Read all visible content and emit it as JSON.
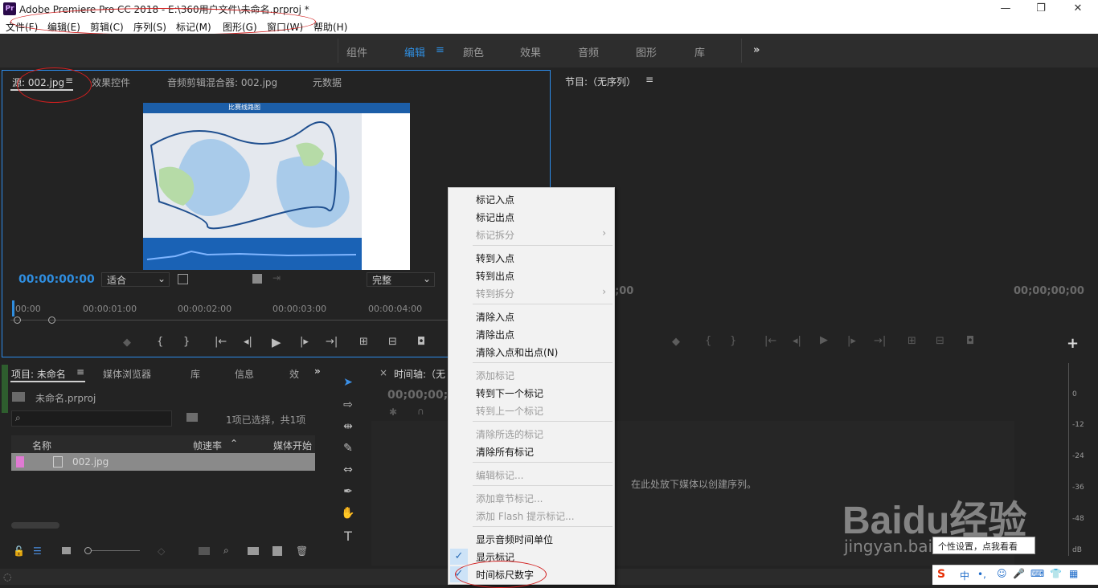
{
  "app": {
    "logo": "Pr",
    "title": "Adobe Premiere Pro CC 2018 - E:\\360用户文件\\未命名.prproj *",
    "min": "—",
    "max": "❐",
    "close": "✕"
  },
  "menu": [
    "文件(F)",
    "编辑(E)",
    "剪辑(C)",
    "序列(S)",
    "标记(M)",
    "图形(G)",
    "窗口(W)",
    "帮助(H)"
  ],
  "workspaces": {
    "items": [
      "组件",
      "编辑",
      "颜色",
      "效果",
      "音频",
      "图形",
      "库"
    ],
    "active": "编辑",
    "more": "»",
    "menu_glyph": "≡"
  },
  "source": {
    "tabs": [
      "源: 002.jpg",
      "效果控件",
      "音频剪辑混合器: 002.jpg",
      "元数据"
    ],
    "timecode": "00:00:00:00",
    "fit": "适合",
    "quality": "完整",
    "ruler": [
      "00:00",
      "00:00:01:00",
      "00:00:02:00",
      "00:00:03:00",
      "00:00:04:00"
    ],
    "image": {
      "header": "比赛线路图",
      "accent": "#1c5ea8"
    }
  },
  "program": {
    "title": "节目:（无序列）",
    "tc_left": ";00",
    "tc_right": "00;00;00;00",
    "add": "+"
  },
  "project": {
    "tabs": [
      "项目: 未命名",
      "媒体浏览器",
      "库",
      "信息",
      "效"
    ],
    "file": "未命名.prproj",
    "selection": "1项已选择，共1项",
    "col_name": "名称",
    "col_fps": "帧速率",
    "col_start": "媒体开始",
    "item": "002.jpg",
    "item_color": "#e07ad3"
  },
  "timeline": {
    "title": "时间轴:（无",
    "timecode": "00;00;00;0",
    "drop_hint": "在此处放下媒体以创建序列。"
  },
  "meter": {
    "labels": [
      "0",
      "-12",
      "-24",
      "-36",
      "-48",
      "dB"
    ]
  },
  "context_menu": {
    "items": [
      {
        "label": "标记入点",
        "enabled": true
      },
      {
        "label": "标记出点",
        "enabled": true
      },
      {
        "label": "标记拆分",
        "enabled": false,
        "submenu": true
      },
      {
        "label": "转到入点",
        "enabled": true
      },
      {
        "label": "转到出点",
        "enabled": true
      },
      {
        "label": "转到拆分",
        "enabled": false,
        "submenu": true
      },
      {
        "label": "清除入点",
        "enabled": true
      },
      {
        "label": "清除出点",
        "enabled": true
      },
      {
        "label": "清除入点和出点(N)",
        "enabled": true
      },
      {
        "label": "添加标记",
        "enabled": false
      },
      {
        "label": "转到下一个标记",
        "enabled": true
      },
      {
        "label": "转到上一个标记",
        "enabled": false
      },
      {
        "label": "清除所选的标记",
        "enabled": false
      },
      {
        "label": "清除所有标记",
        "enabled": true
      },
      {
        "label": "编辑标记...",
        "enabled": false
      },
      {
        "label": "添加章节标记...",
        "enabled": false
      },
      {
        "label": "添加 Flash 提示标记...",
        "enabled": false
      },
      {
        "label": "显示音频时间单位",
        "enabled": true
      },
      {
        "label": "显示标记",
        "enabled": true,
        "checked": true
      },
      {
        "label": "时间标尺数字",
        "enabled": true,
        "checked": true
      }
    ],
    "arrow": "›",
    "check": "✓"
  },
  "watermark": {
    "brand": "Bai",
    "logo": "du",
    "cn": "经验",
    "url": "jingyan.baidu.com"
  },
  "tooltip": "个性设置，点我看看",
  "tray": {
    "items": [
      "S",
      "中",
      "•,",
      "☺",
      "🎤",
      "⌨",
      "👕",
      "▦"
    ]
  }
}
